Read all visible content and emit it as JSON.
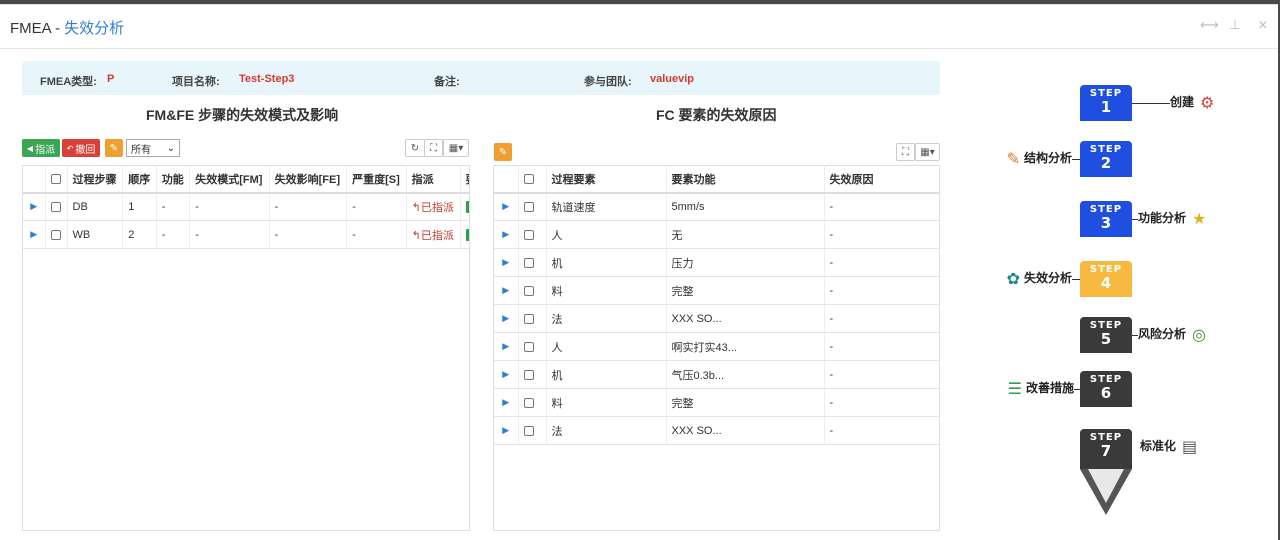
{
  "window": {
    "title_prefix": "FMEA - ",
    "title_sub": "失效分析",
    "controls": [
      "⟷",
      "⊥",
      "×"
    ]
  },
  "info": {
    "type_label": "FMEA类型:",
    "type_value": "P",
    "project_label": "项目名称:",
    "project_value": "Test-Step3",
    "remark_label": "备注:",
    "remark_value": "",
    "team_label": "参与团队:",
    "team_value": "valuevip"
  },
  "left": {
    "title": "FM&FE 步骤的失效模式及影响",
    "assign_btn": "指派",
    "revoke_btn": "撤回",
    "filter_value": "所有",
    "columns": [
      "过程步骤",
      "顺序",
      "功能",
      "失效模式[FM]",
      "失效影响[FE]",
      "严重度[S]",
      "指派",
      "要"
    ],
    "rows": [
      {
        "step": "DB",
        "order": "1",
        "func": "-",
        "fm": "-",
        "fe": "-",
        "s": "-",
        "assign": "已指派"
      },
      {
        "step": "WB",
        "order": "2",
        "func": "-",
        "fm": "-",
        "fe": "-",
        "s": "-",
        "assign": "已指派"
      }
    ]
  },
  "right": {
    "title": "FC 要素的失效原因",
    "columns": [
      "过程要素",
      "要素功能",
      "失效原因"
    ],
    "rows": [
      {
        "elem": "轨道速度",
        "func": "5mm/s",
        "cause": "-"
      },
      {
        "elem": "人",
        "func": "无",
        "cause": "-"
      },
      {
        "elem": "机",
        "func": "压力",
        "cause": "-"
      },
      {
        "elem": "料",
        "func": "完整",
        "cause": "-"
      },
      {
        "elem": "法",
        "func": "XXX SO...",
        "cause": "-"
      },
      {
        "elem": "人",
        "func": "啊实打实43...",
        "cause": "-"
      },
      {
        "elem": "机",
        "func": "气压0.3b...",
        "cause": "-"
      },
      {
        "elem": "料",
        "func": "完整",
        "cause": "-"
      },
      {
        "elem": "法",
        "func": "XXX SO...",
        "cause": "-"
      }
    ]
  },
  "steps": [
    {
      "word": "STEP",
      "num": "1",
      "label": "创建",
      "color": "#1f4fe0",
      "icon": "gear-icon"
    },
    {
      "word": "STEP",
      "num": "2",
      "label": "结构分析",
      "color": "#1f4fe0",
      "icon": "pencil-icon"
    },
    {
      "word": "STEP",
      "num": "3",
      "label": "功能分析",
      "color": "#1f4fe0",
      "icon": "star-icon"
    },
    {
      "word": "STEP",
      "num": "4",
      "label": "失效分析",
      "color": "#f7b940",
      "icon": "cluster-icon"
    },
    {
      "word": "STEP",
      "num": "5",
      "label": "风险分析",
      "color": "#3a3a3a",
      "icon": "target-icon"
    },
    {
      "word": "STEP",
      "num": "6",
      "label": "改善措施",
      "color": "#3a3a3a",
      "icon": "list-icon"
    },
    {
      "word": "STEP",
      "num": "7",
      "label": "标准化",
      "color": "#3a3a3a",
      "icon": "document-icon"
    }
  ]
}
